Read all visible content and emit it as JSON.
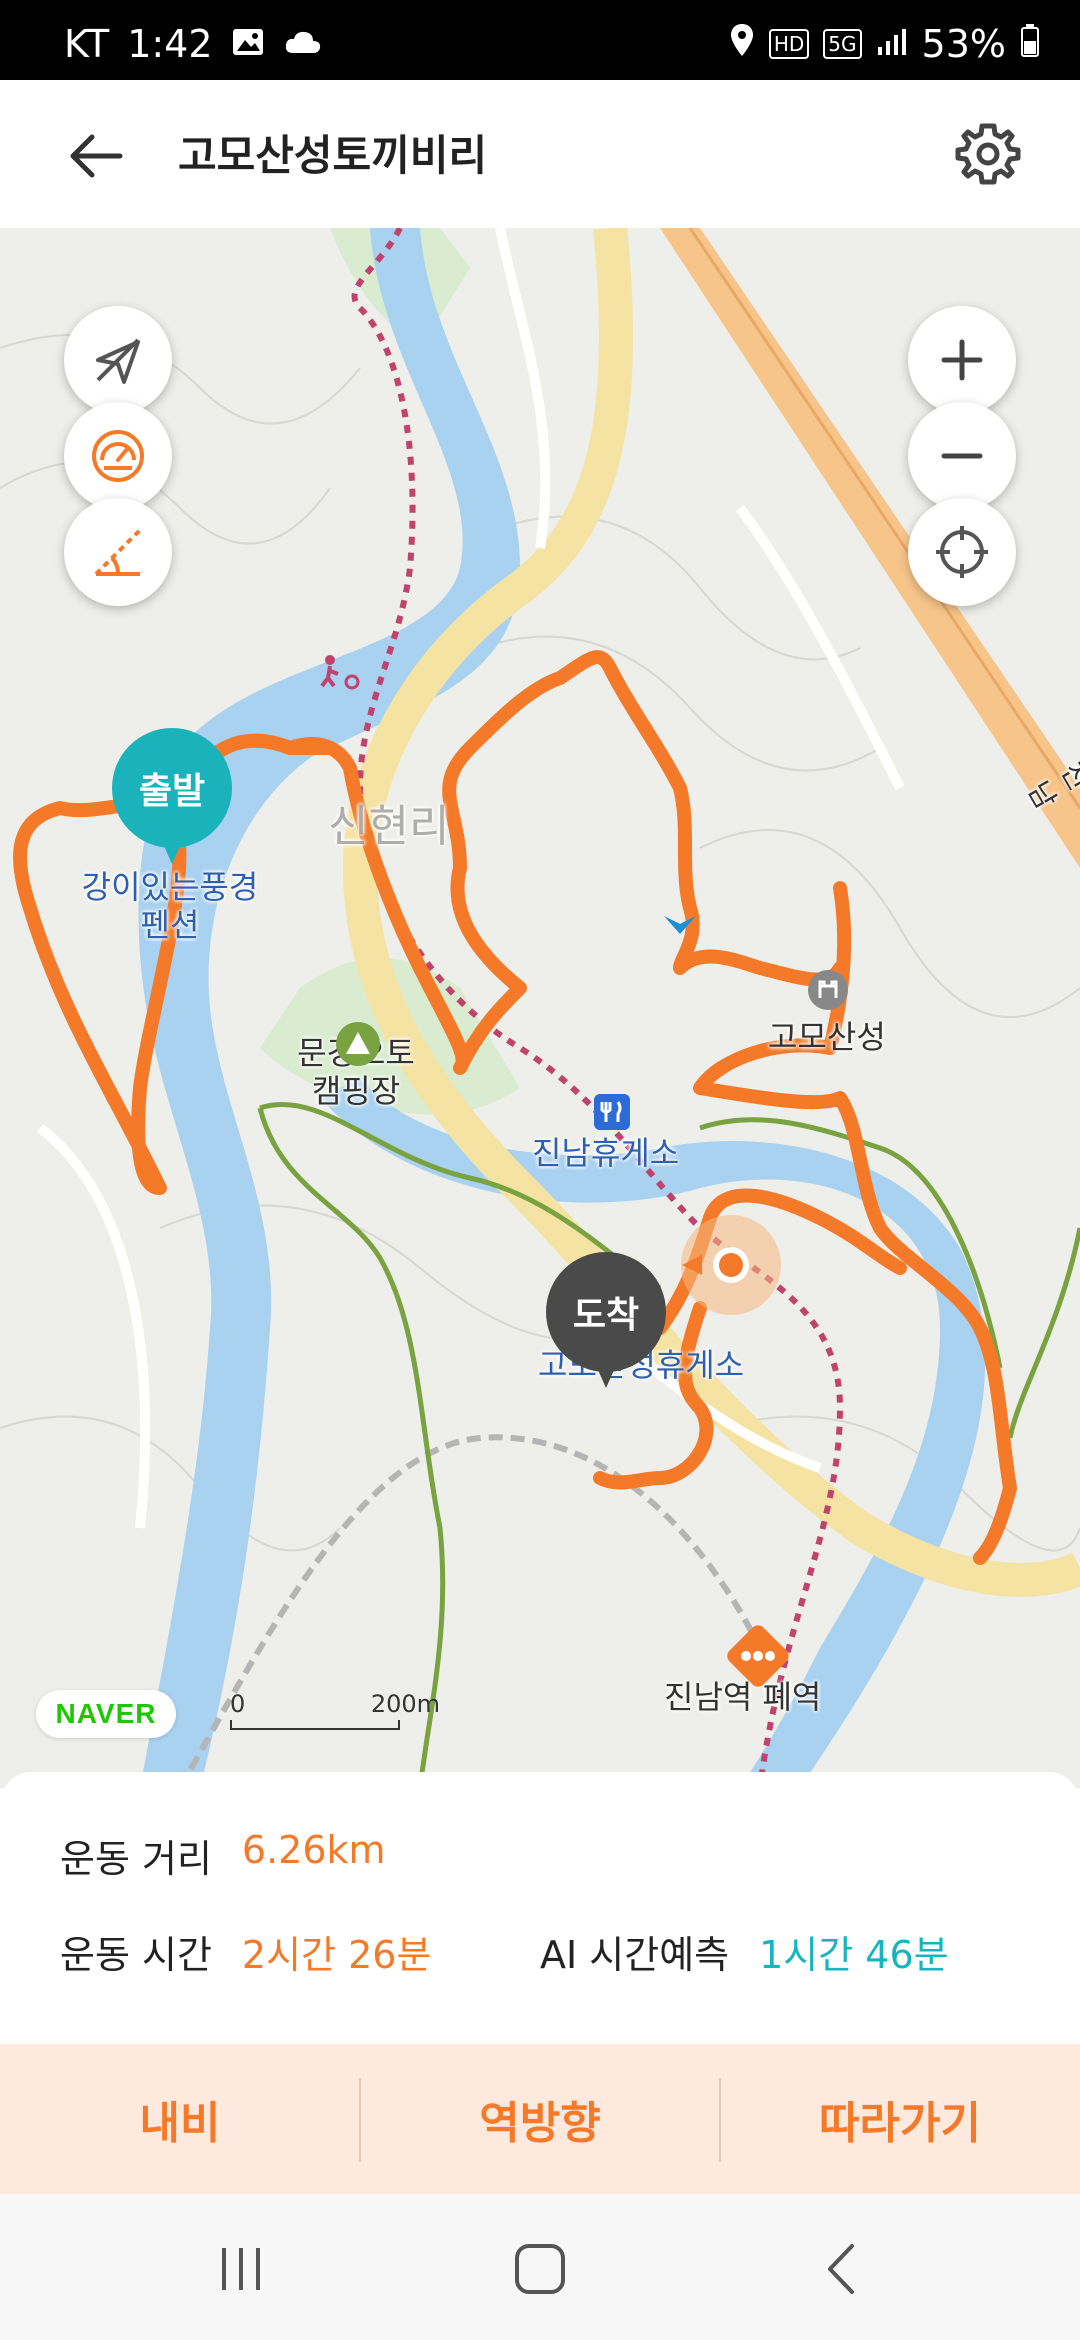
{
  "status_bar": {
    "carrier": "KT",
    "time": "1:42",
    "network_badge": "HD",
    "network_type": "5G",
    "battery": "53%"
  },
  "header": {
    "title": "고모산성토끼비리"
  },
  "map": {
    "labels": {
      "pension": "강이있는풍경\n펜션",
      "village": "신현리",
      "camping": "문경오토\n캠핑장",
      "rest_area_1": "진남휴게소",
      "fortress": "고모산성",
      "rest_area_2": "고모산성휴게소",
      "station": "진남역 폐역",
      "road_edge": "진남"
    },
    "markers": {
      "start": "출발",
      "end": "도착"
    },
    "brand": "NAVER",
    "scale": {
      "zero": "0",
      "max": "200m"
    }
  },
  "info": {
    "distance_label": "운동 거리",
    "distance_value": "6.26km",
    "time_label": "운동 시간",
    "time_value": "2시간 26분",
    "ai_label": "AI 시간예측",
    "ai_value": "1시간 46분"
  },
  "actions": {
    "navi": "내비",
    "reverse": "역방향",
    "follow": "따라가기"
  },
  "colors": {
    "accent": "#f47a2a",
    "teal": "#16b4bf",
    "route": "#f47a2a",
    "action_bg": "#fde9de"
  }
}
